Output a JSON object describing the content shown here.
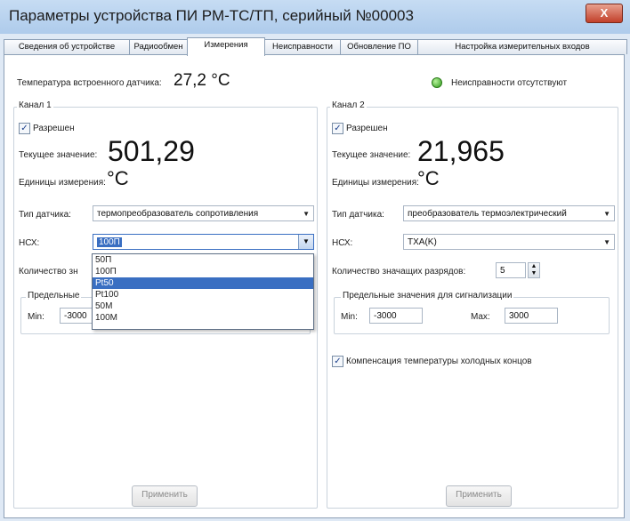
{
  "window": {
    "title": "Параметры устройства ПИ РМ-ТС/ТП, серийный №00003",
    "close_glyph": "X"
  },
  "tabs": [
    {
      "label": "Сведения об устройстве"
    },
    {
      "label": "Радиообмен"
    },
    {
      "label": "Измерения"
    },
    {
      "label": "Неисправности"
    },
    {
      "label": "Обновление ПО"
    },
    {
      "label": "Настройка измерительных входов"
    }
  ],
  "active_tab": "Измерения",
  "header": {
    "internal_temp_label": "Температура встроенного датчика:",
    "internal_temp_value": "27,2 °С",
    "fault_status": "Неисправности отсутствуют",
    "fault_led_color": "#2f9a1c"
  },
  "channel1": {
    "title": "Канал 1",
    "enabled_label": "Разрешен",
    "enabled": true,
    "current_label": "Текущее значение:",
    "current_value": "501,29",
    "units_label": "Единицы измерения:",
    "units_value": "°С",
    "sensor_type_label": "Тип датчика:",
    "sensor_type_value": "термопреобразователь сопротивления",
    "nsh_label": "НСХ:",
    "nsh_value": "100П",
    "digits_label": "Количество зн",
    "limits_title": "Предельные",
    "min_label": "Min:",
    "min_value": "-3000",
    "apply_label": "Применить"
  },
  "dropdown": {
    "options": [
      "50П",
      "100П",
      "Pt50",
      "Pt100",
      "50M",
      "100M"
    ],
    "selected": "Pt50"
  },
  "channel2": {
    "title": "Канал 2",
    "enabled_label": "Разрешен",
    "enabled": true,
    "current_label": "Текущее значение:",
    "current_value": "21,965",
    "units_label": "Единицы измерения:",
    "units_value": "°С",
    "sensor_type_label": "Тип датчика:",
    "sensor_type_value": "преобразователь термоэлектрический",
    "nsh_label": "НСХ:",
    "nsh_value": "ТХА(K)",
    "digits_label": "Количество значащих разрядов:",
    "digits_value": "5",
    "limits_title": "Предельные значения для сигнализации",
    "min_label": "Min:",
    "min_value": "-3000",
    "max_label": "Max:",
    "max_value": "3000",
    "cold_junction_label": "Компенсация температуры холодных концов",
    "cold_junction": true,
    "apply_label": "Применить"
  }
}
